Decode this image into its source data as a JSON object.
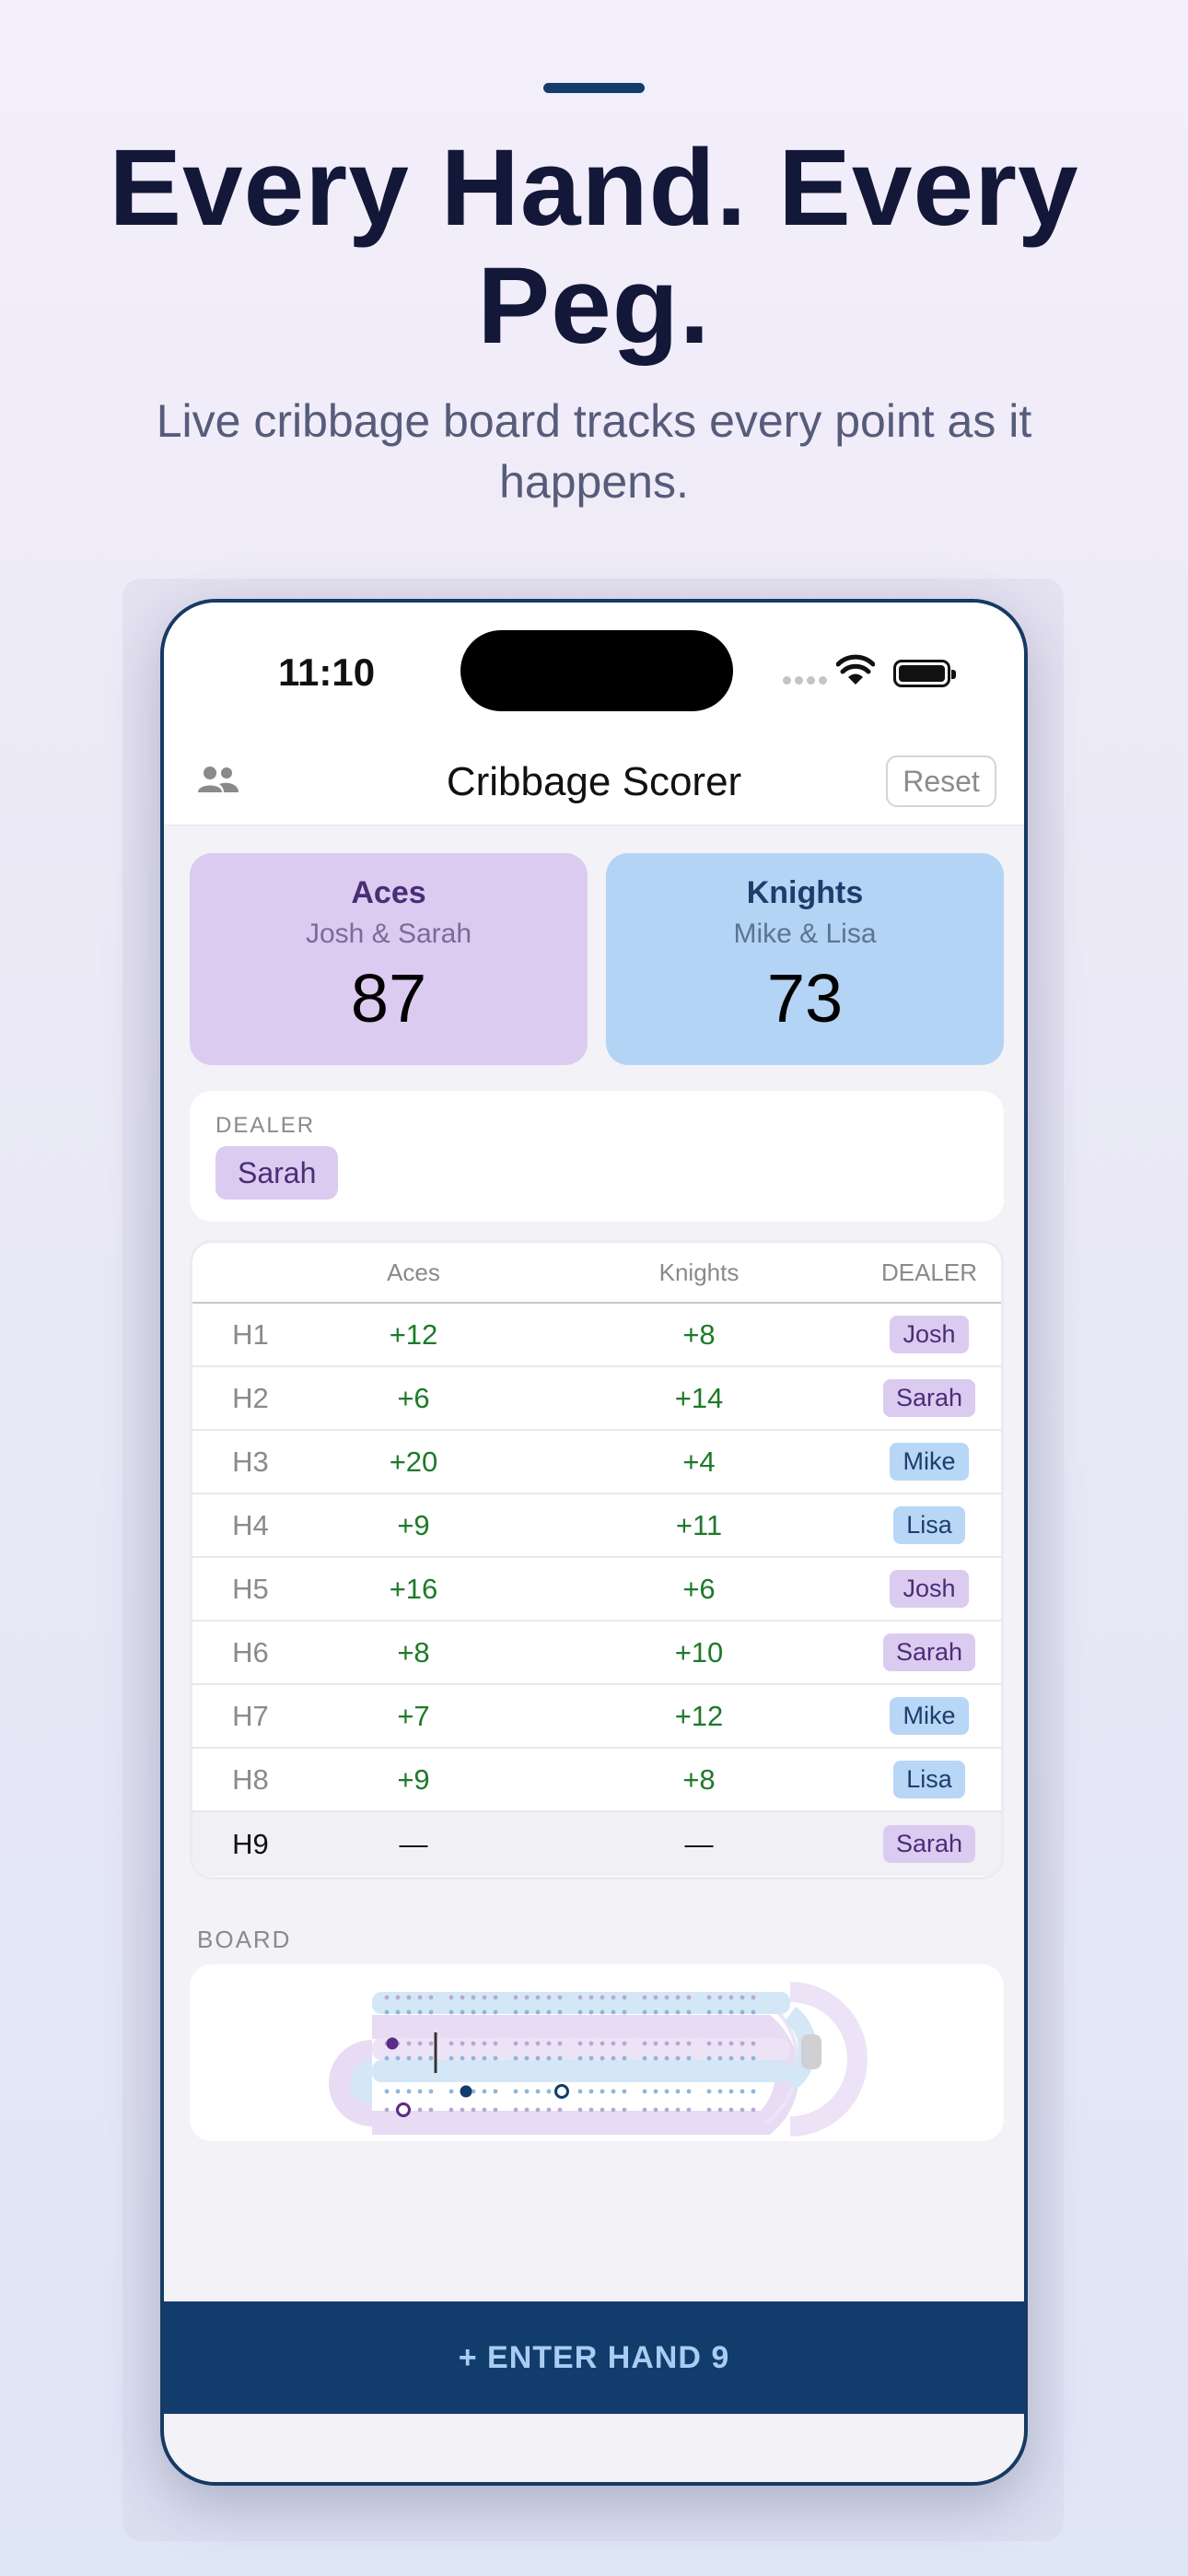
{
  "hero": {
    "headline": "Every Hand. Every Peg.",
    "subhead": "Live cribbage board tracks every point as it happens."
  },
  "status_bar": {
    "time": "11:10"
  },
  "nav": {
    "title": "Cribbage Scorer",
    "reset_label": "Reset",
    "left_icon": "people-icon"
  },
  "teams": [
    {
      "name": "Aces",
      "players": "Josh & Sarah",
      "score": "87",
      "color": "#dccbf0"
    },
    {
      "name": "Knights",
      "players": "Mike & Lisa",
      "score": "73",
      "color": "#b3d4f5"
    }
  ],
  "dealer": {
    "label": "DEALER",
    "name": "Sarah"
  },
  "hands_table": {
    "columns": [
      "",
      "Aces",
      "Knights",
      "DEALER"
    ],
    "rows": [
      {
        "hand": "H1",
        "aces": "+12",
        "knights": "+8",
        "dealer": "Josh"
      },
      {
        "hand": "H2",
        "aces": "+6",
        "knights": "+14",
        "dealer": "Sarah"
      },
      {
        "hand": "H3",
        "aces": "+20",
        "knights": "+4",
        "dealer": "Mike"
      },
      {
        "hand": "H4",
        "aces": "+9",
        "knights": "+11",
        "dealer": "Lisa"
      },
      {
        "hand": "H5",
        "aces": "+16",
        "knights": "+6",
        "dealer": "Josh"
      },
      {
        "hand": "H6",
        "aces": "+8",
        "knights": "+10",
        "dealer": "Sarah"
      },
      {
        "hand": "H7",
        "aces": "+7",
        "knights": "+12",
        "dealer": "Mike"
      },
      {
        "hand": "H8",
        "aces": "+9",
        "knights": "+8",
        "dealer": "Lisa"
      },
      {
        "hand": "H9",
        "aces": "—",
        "knights": "—",
        "dealer": "Sarah"
      }
    ]
  },
  "board": {
    "label": "BOARD",
    "icon": "cribbage-board"
  },
  "cta": {
    "label": "+ ENTER HAND 9"
  },
  "colors": {
    "accent_navy": "#123c6b",
    "aces_purple": "#dccbf0",
    "knights_blue": "#b3d4f5",
    "points_green": "#1e7a2a"
  }
}
